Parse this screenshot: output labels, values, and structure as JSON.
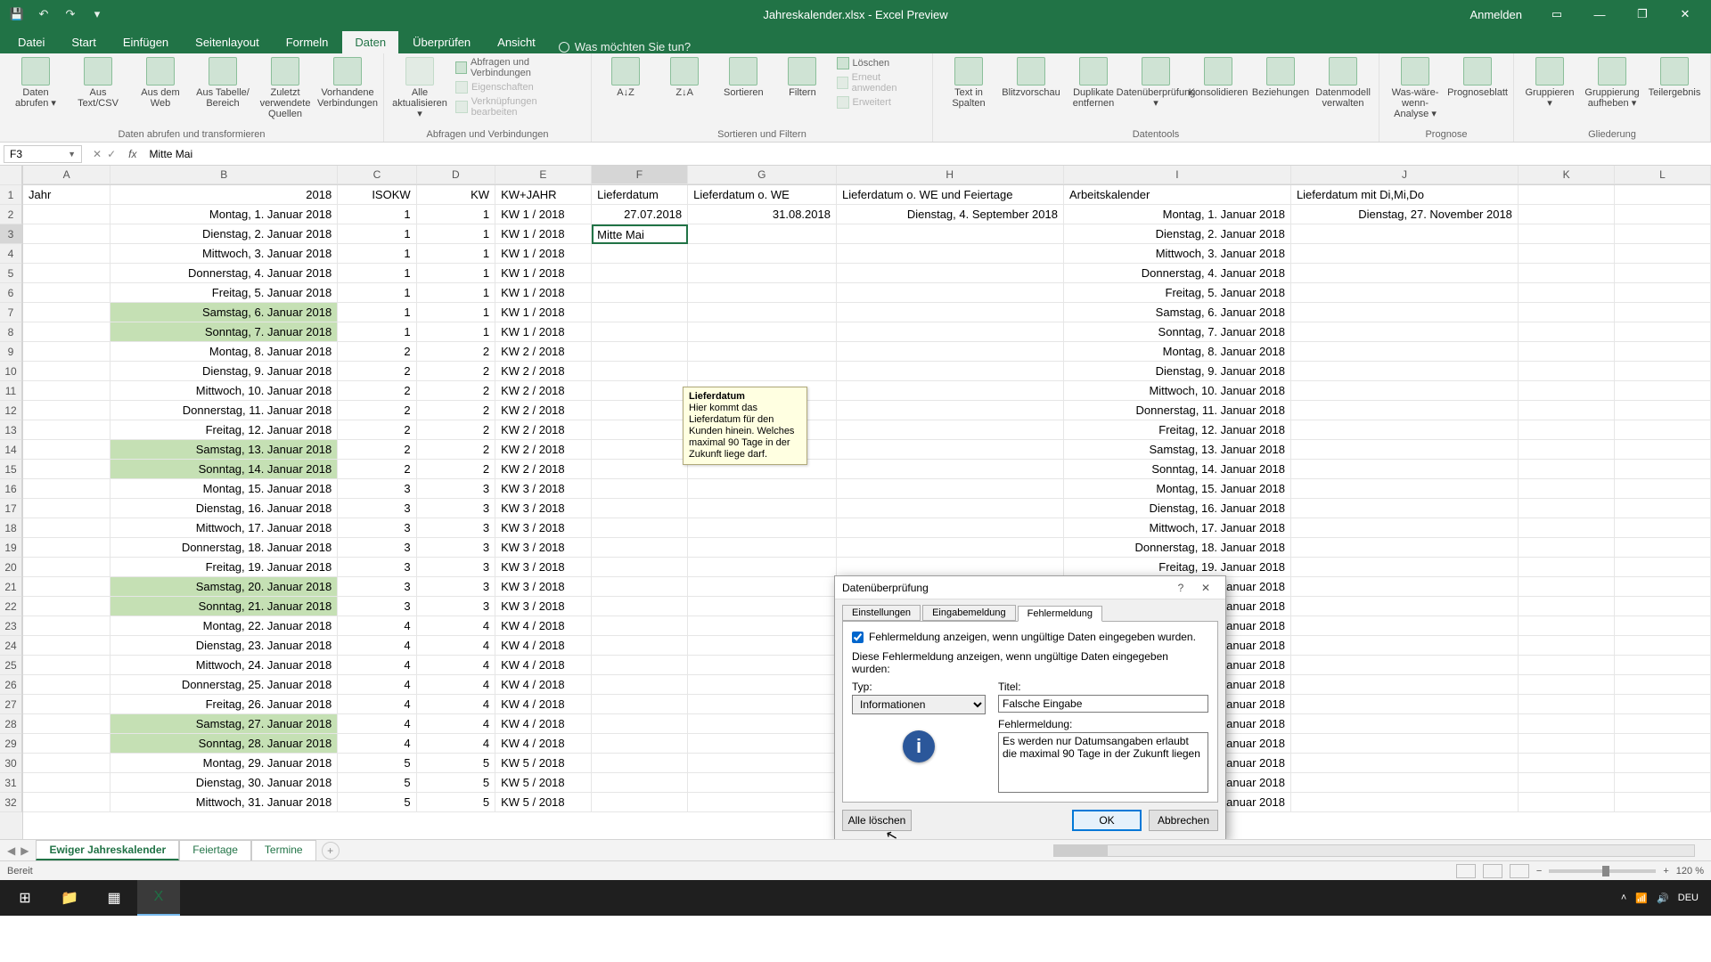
{
  "app": {
    "title": "Jahreskalender.xlsx - Excel Preview",
    "signin": "Anmelden"
  },
  "tabs": [
    "Datei",
    "Start",
    "Einfügen",
    "Seitenlayout",
    "Formeln",
    "Daten",
    "Überprüfen",
    "Ansicht"
  ],
  "active_tab": 5,
  "tellme": "Was möchten Sie tun?",
  "ribbon_groups": {
    "g1": {
      "label": "Daten abrufen und transformieren",
      "btns": [
        "Daten abrufen ▾",
        "Aus Text/CSV",
        "Aus dem Web",
        "Aus Tabelle/ Bereich",
        "Zuletzt verwendete Quellen",
        "Vorhandene Verbindungen"
      ]
    },
    "g2": {
      "label": "Abfragen und Verbindungen",
      "btn": "Alle aktualisieren ▾",
      "lines": [
        "Abfragen und Verbindungen",
        "Eigenschaften",
        "Verknüpfungen bearbeiten"
      ]
    },
    "g3": {
      "label": "Sortieren und Filtern",
      "btns": [
        "A↓Z",
        "Z↓A",
        "Sortieren",
        "Filtern"
      ],
      "lines": [
        "Löschen",
        "Erneut anwenden",
        "Erweitert"
      ]
    },
    "g4": {
      "label": "Datentools",
      "btns": [
        "Text in Spalten",
        "Blitzvorschau",
        "Duplikate entfernen",
        "Datenüberprüfung ▾",
        "Konsolidieren",
        "Beziehungen",
        "Datenmodell verwalten"
      ]
    },
    "g5": {
      "label": "Prognose",
      "btns": [
        "Was-wäre-wenn-Analyse ▾",
        "Prognoseblatt"
      ]
    },
    "g6": {
      "label": "Gliederung",
      "btns": [
        "Gruppieren ▾",
        "Gruppierung aufheben ▾",
        "Teilergebnis"
      ]
    }
  },
  "namebox": "F3",
  "formula_value": "Mitte Mai",
  "columns": [
    "A",
    "B",
    "C",
    "D",
    "E",
    "F",
    "G",
    "H",
    "I",
    "J",
    "K",
    "L"
  ],
  "headers": {
    "A": "Jahr",
    "B": "2018",
    "C": "ISOKW",
    "D": "KW",
    "E": "KW+JAHR",
    "F": "Lieferdatum",
    "G": "Lieferdatum o. WE",
    "H": "Lieferdatum o. WE und Feiertage",
    "I": "Arbeitskalender",
    "J": "Lieferdatum mit Di,Mi,Do"
  },
  "row2": {
    "F": "27.07.2018",
    "G": "31.08.2018",
    "H": "Dienstag, 4. September 2018",
    "I": "Montag, 1. Januar 2018",
    "J": "Dienstag, 27. November 2018"
  },
  "editing_cell": "Mitte Mai",
  "rows": [
    {
      "n": 2,
      "B": "Montag, 1. Januar 2018",
      "C": 1,
      "D": 1,
      "E": "KW 1 / 2018",
      "I": "Montag, 1. Januar 2018",
      "g": false
    },
    {
      "n": 3,
      "B": "Dienstag, 2. Januar 2018",
      "C": 1,
      "D": 1,
      "E": "KW 1 / 2018",
      "I": "Dienstag, 2. Januar 2018",
      "g": false
    },
    {
      "n": 4,
      "B": "Mittwoch, 3. Januar 2018",
      "C": 1,
      "D": 1,
      "E": "KW 1 / 2018",
      "I": "Mittwoch, 3. Januar 2018",
      "g": false
    },
    {
      "n": 5,
      "B": "Donnerstag, 4. Januar 2018",
      "C": 1,
      "D": 1,
      "E": "KW 1 / 2018",
      "I": "Donnerstag, 4. Januar 2018",
      "g": false
    },
    {
      "n": 6,
      "B": "Freitag, 5. Januar 2018",
      "C": 1,
      "D": 1,
      "E": "KW 1 / 2018",
      "I": "Freitag, 5. Januar 2018",
      "g": false
    },
    {
      "n": 7,
      "B": "Samstag, 6. Januar 2018",
      "C": 1,
      "D": 1,
      "E": "KW 1 / 2018",
      "I": "Samstag, 6. Januar 2018",
      "g": true
    },
    {
      "n": 8,
      "B": "Sonntag, 7. Januar 2018",
      "C": 1,
      "D": 1,
      "E": "KW 1 / 2018",
      "I": "Sonntag, 7. Januar 2018",
      "g": true
    },
    {
      "n": 9,
      "B": "Montag, 8. Januar 2018",
      "C": 2,
      "D": 2,
      "E": "KW 2 / 2018",
      "I": "Montag, 8. Januar 2018",
      "g": false
    },
    {
      "n": 10,
      "B": "Dienstag, 9. Januar 2018",
      "C": 2,
      "D": 2,
      "E": "KW 2 / 2018",
      "I": "Dienstag, 9. Januar 2018",
      "g": false
    },
    {
      "n": 11,
      "B": "Mittwoch, 10. Januar 2018",
      "C": 2,
      "D": 2,
      "E": "KW 2 / 2018",
      "I": "Mittwoch, 10. Januar 2018",
      "g": false
    },
    {
      "n": 12,
      "B": "Donnerstag, 11. Januar 2018",
      "C": 2,
      "D": 2,
      "E": "KW 2 / 2018",
      "I": "Donnerstag, 11. Januar 2018",
      "g": false
    },
    {
      "n": 13,
      "B": "Freitag, 12. Januar 2018",
      "C": 2,
      "D": 2,
      "E": "KW 2 / 2018",
      "I": "Freitag, 12. Januar 2018",
      "g": false
    },
    {
      "n": 14,
      "B": "Samstag, 13. Januar 2018",
      "C": 2,
      "D": 2,
      "E": "KW 2 / 2018",
      "I": "Samstag, 13. Januar 2018",
      "g": true
    },
    {
      "n": 15,
      "B": "Sonntag, 14. Januar 2018",
      "C": 2,
      "D": 2,
      "E": "KW 2 / 2018",
      "I": "Sonntag, 14. Januar 2018",
      "g": true
    },
    {
      "n": 16,
      "B": "Montag, 15. Januar 2018",
      "C": 3,
      "D": 3,
      "E": "KW 3 / 2018",
      "I": "Montag, 15. Januar 2018",
      "g": false
    },
    {
      "n": 17,
      "B": "Dienstag, 16. Januar 2018",
      "C": 3,
      "D": 3,
      "E": "KW 3 / 2018",
      "I": "Dienstag, 16. Januar 2018",
      "g": false
    },
    {
      "n": 18,
      "B": "Mittwoch, 17. Januar 2018",
      "C": 3,
      "D": 3,
      "E": "KW 3 / 2018",
      "I": "Mittwoch, 17. Januar 2018",
      "g": false
    },
    {
      "n": 19,
      "B": "Donnerstag, 18. Januar 2018",
      "C": 3,
      "D": 3,
      "E": "KW 3 / 2018",
      "I": "Donnerstag, 18. Januar 2018",
      "g": false
    },
    {
      "n": 20,
      "B": "Freitag, 19. Januar 2018",
      "C": 3,
      "D": 3,
      "E": "KW 3 / 2018",
      "I": "Freitag, 19. Januar 2018",
      "g": false
    },
    {
      "n": 21,
      "B": "Samstag, 20. Januar 2018",
      "C": 3,
      "D": 3,
      "E": "KW 3 / 2018",
      "I": "Samstag, 20. Januar 2018",
      "g": true
    },
    {
      "n": 22,
      "B": "Sonntag, 21. Januar 2018",
      "C": 3,
      "D": 3,
      "E": "KW 3 / 2018",
      "I": "Sonntag, 21. Januar 2018",
      "g": true
    },
    {
      "n": 23,
      "B": "Montag, 22. Januar 2018",
      "C": 4,
      "D": 4,
      "E": "KW 4 / 2018",
      "I": "Montag, 22. Januar 2018",
      "g": false
    },
    {
      "n": 24,
      "B": "Dienstag, 23. Januar 2018",
      "C": 4,
      "D": 4,
      "E": "KW 4 / 2018",
      "I": "Dienstag, 23. Januar 2018",
      "g": false
    },
    {
      "n": 25,
      "B": "Mittwoch, 24. Januar 2018",
      "C": 4,
      "D": 4,
      "E": "KW 4 / 2018",
      "I": "Mittwoch, 24. Januar 2018",
      "g": false
    },
    {
      "n": 26,
      "B": "Donnerstag, 25. Januar 2018",
      "C": 4,
      "D": 4,
      "E": "KW 4 / 2018",
      "I": "Donnerstag, 25. Januar 2018",
      "g": false
    },
    {
      "n": 27,
      "B": "Freitag, 26. Januar 2018",
      "C": 4,
      "D": 4,
      "E": "KW 4 / 2018",
      "I": "Freitag, 26. Januar 2018",
      "g": false
    },
    {
      "n": 28,
      "B": "Samstag, 27. Januar 2018",
      "C": 4,
      "D": 4,
      "E": "KW 4 / 2018",
      "I": "Samstag, 27. Januar 2018",
      "g": true
    },
    {
      "n": 29,
      "B": "Sonntag, 28. Januar 2018",
      "C": 4,
      "D": 4,
      "E": "KW 4 / 2018",
      "I": "Sonntag, 28. Januar 2018",
      "g": true
    },
    {
      "n": 30,
      "B": "Montag, 29. Januar 2018",
      "C": 5,
      "D": 5,
      "E": "KW 5 / 2018",
      "I": "Montag, 29. Januar 2018",
      "g": false
    },
    {
      "n": 31,
      "B": "Dienstag, 30. Januar 2018",
      "C": 5,
      "D": 5,
      "E": "KW 5 / 2018",
      "I": "Dienstag, 30. Januar 2018",
      "g": false
    },
    {
      "n": 32,
      "B": "Mittwoch, 31. Januar 2018",
      "C": 5,
      "D": 5,
      "E": "KW 5 / 2018",
      "I": "Mittwoch, 31. Januar 2018",
      "g": false
    }
  ],
  "tooltip": {
    "title": "Lieferdatum",
    "body": "Hier kommt das Lieferdatum für den Kunden hinein. Welches maximal 90 Tage in der Zukunft liege darf."
  },
  "dialog": {
    "title": "Datenüberprüfung",
    "tabs": [
      "Einstellungen",
      "Eingabemeldung",
      "Fehlermeldung"
    ],
    "active_tab": 2,
    "checkbox": "Fehlermeldung anzeigen, wenn ungültige Daten eingegeben wurden.",
    "instr": "Diese Fehlermeldung anzeigen, wenn ungültige Daten eingegeben wurden:",
    "typ_label": "Typ:",
    "typ_value": "Informationen",
    "titel_label": "Titel:",
    "titel_value": "Falsche Eingabe",
    "msg_label": "Fehlermeldung:",
    "msg_value": "Es werden nur Datumsangaben erlaubt die maximal 90 Tage in der Zukunft liegen",
    "btn_clear": "Alle löschen",
    "btn_ok": "OK",
    "btn_cancel": "Abbrechen"
  },
  "sheets": [
    "Ewiger Jahreskalender",
    "Feiertage",
    "Termine"
  ],
  "active_sheet": 0,
  "status": "Bereit",
  "zoom": "120 %"
}
